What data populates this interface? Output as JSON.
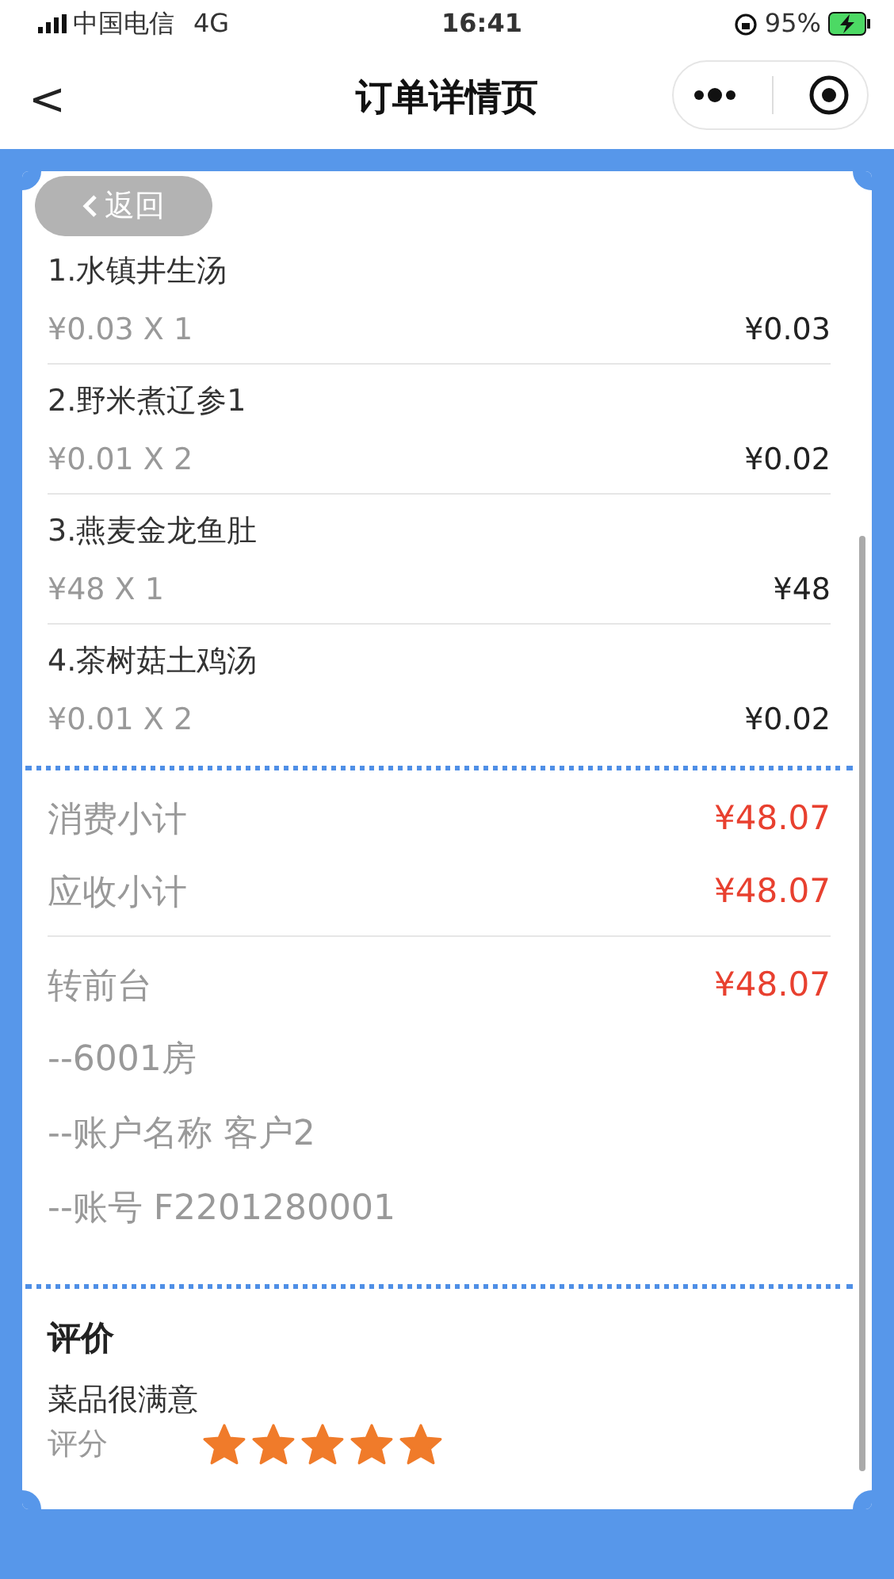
{
  "status_bar": {
    "carrier": "中国电信",
    "network": "4G",
    "time": "16:41",
    "battery": "95%"
  },
  "nav": {
    "back": "<",
    "title": "订单详情页"
  },
  "overlay_back": {
    "label": "返回"
  },
  "items": [
    {
      "name": "1.水镇井生汤",
      "unit": "¥0.03 X 1",
      "total": "¥0.03"
    },
    {
      "name": "2.野米煮辽参1",
      "unit": "¥0.01 X 2",
      "total": "¥0.02"
    },
    {
      "name": "3.燕麦金龙鱼肚",
      "unit": "¥48 X 1",
      "total": "¥48"
    },
    {
      "name": "4.茶树菇土鸡汤",
      "unit": "¥0.01 X 2",
      "total": "¥0.02"
    }
  ],
  "summary": [
    {
      "label": "消费小计",
      "value": "¥48.07"
    },
    {
      "label": "应收小计",
      "value": "¥48.07"
    }
  ],
  "payment": {
    "label": "转前台",
    "value": "¥48.07",
    "details": [
      "--6001房",
      "--账户名称 客户2",
      "--账号 F2201280001"
    ]
  },
  "review": {
    "title": "评价",
    "comment": "菜品很满意",
    "score_label": "评分",
    "stars": 5
  }
}
